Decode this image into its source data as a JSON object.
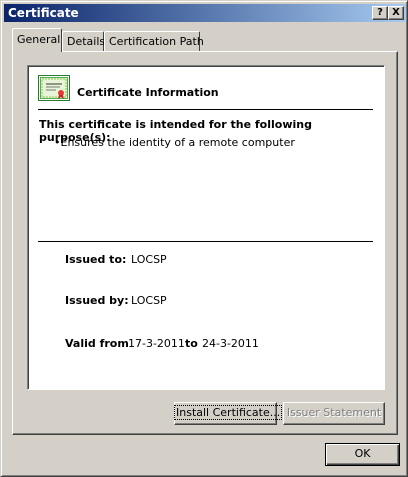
{
  "window": {
    "title": "Certificate",
    "help_label": "?",
    "close_label": "X"
  },
  "tabs": [
    {
      "label": "General",
      "active": true
    },
    {
      "label": "Details",
      "active": false
    },
    {
      "label": "Certification Path",
      "active": false
    }
  ],
  "general": {
    "info_title": "Certificate Information",
    "purpose_heading": "This certificate is intended for the following purpose(s):",
    "purposes": [
      "•Ensures the identity of a remote computer"
    ],
    "issued_to_label": "Issued to:",
    "issued_to": "LOCSP",
    "issued_by_label": "Issued by:",
    "issued_by": "LOCSP",
    "valid_from_label": "Valid from",
    "valid_from": "17-3-2011",
    "valid_to_label": "to",
    "valid_to": "24-3-2011"
  },
  "buttons": {
    "install": "Install Certificate...",
    "issuer_statement": "Issuer Statement",
    "ok": "OK"
  },
  "icons": {
    "certificate": "certificate-icon"
  },
  "colors": {
    "titlebar_start": "#0a246a",
    "titlebar_end": "#a6caf0",
    "face": "#d4d0c8"
  }
}
